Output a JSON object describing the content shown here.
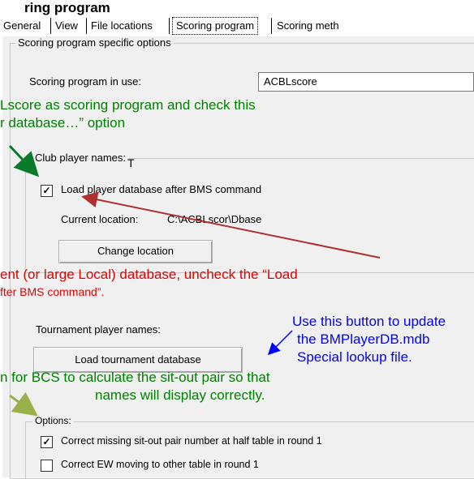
{
  "header": {
    "title_fragment": "ring program"
  },
  "tabs": [
    {
      "label": "General"
    },
    {
      "label": "View"
    },
    {
      "label": "File locations"
    },
    {
      "label": "Scoring program"
    },
    {
      "label": "Scoring meth"
    }
  ],
  "scoring_group": {
    "legend": "Scoring program specific options",
    "program_label": "Scoring program in use:",
    "program_value": "ACBLscore"
  },
  "club_group": {
    "legend": "Club player names:",
    "cursor_glyph": "T",
    "load_checkbox_label": "Load player database after BMS command",
    "load_checked": true,
    "current_location_label": "Current location:",
    "current_location_value": "C:\\ACBLscor\\Dbase",
    "change_location_button": "Change location"
  },
  "tournament": {
    "label": "Tournament player names:",
    "load_button": "Load tournament database"
  },
  "options_group": {
    "legend": "Options:",
    "items": [
      {
        "label": "Correct missing sit-out pair number at half table in round 1",
        "checked": true
      },
      {
        "label": "Correct EW moving to other table in round 1",
        "checked": false
      }
    ]
  },
  "annotations": {
    "green_1_line1": "Lscore as scoring program and check this",
    "green_1_line2": "r database…” option",
    "red_line1": "ent (or large Local) database, uncheck the “Load",
    "red_line2": "fter BMS command”.",
    "blue_line1": "Use this button to update",
    "blue_line2": "the BMPlayerDB.mdb",
    "blue_line3": "Special lookup file.",
    "green_2_line1": "n for BCS to calculate the sit-out pair so that",
    "green_2_line2": "names will display correctly."
  },
  "colors": {
    "green": "#008000",
    "red": "#e00000",
    "blue": "#0000ff",
    "dark_red_arrow": "#b03030",
    "dialog_bg": "#f0f0f0"
  }
}
